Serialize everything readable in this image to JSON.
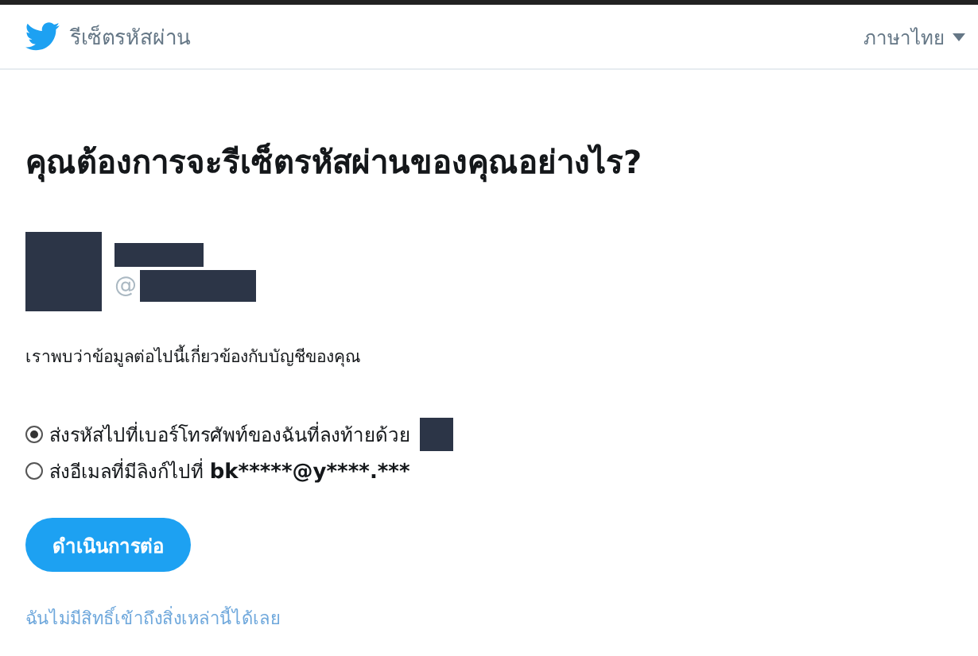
{
  "header": {
    "title": "รีเซ็ตรหัสผ่าน",
    "language": "ภาษาไทย"
  },
  "heading": "คุณต้องการจะรีเซ็ตรหัสผ่านของคุณอย่างไร?",
  "account": {
    "handle_prefix": "@"
  },
  "info": "เราพบว่าข้อมูลต่อไปนี้เกี่ยวข้องกับบัญชีของคุณ",
  "options": [
    {
      "label": "ส่งรหัสไปที่เบอร์โทรศัพท์ของฉันที่ลงท้ายด้วย",
      "selected": true,
      "redacted_suffix": true
    },
    {
      "label": "ส่งอีเมลที่มีลิงก์ไปที่",
      "value": "bk*****@y****.***",
      "selected": false,
      "redacted_suffix": false
    }
  ],
  "button": "ดำเนินการต่อ",
  "link": "ฉันไม่มีสิทธิ์เข้าถึงสิ่งเหล่านี้ได้เลย"
}
